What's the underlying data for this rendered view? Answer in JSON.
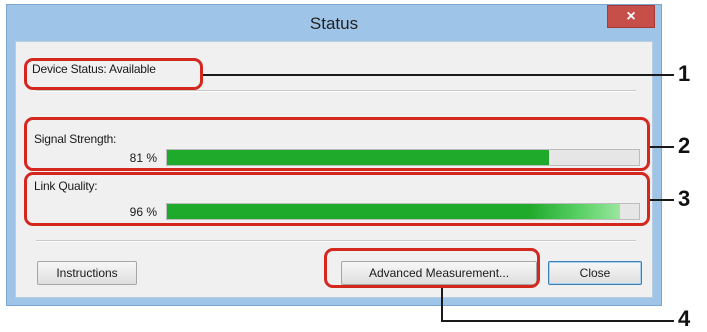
{
  "dialog": {
    "title": "Status",
    "close_glyph": "×"
  },
  "device_status": {
    "label": "Device Status: Available"
  },
  "signal_strength": {
    "label": "Signal Strength:",
    "value_text": "81 %",
    "value": 0.81,
    "bar_color": "#1faa2c"
  },
  "link_quality": {
    "label": "Link Quality:",
    "value_text": "96 %",
    "value": 0.96,
    "bar_color": "#1faa2c"
  },
  "buttons": {
    "instructions": "Instructions",
    "advanced": "Advanced Measurement...",
    "close": "Close"
  },
  "callouts": {
    "c1": "1",
    "c2": "2",
    "c3": "3",
    "c4": "4",
    "color": "#d4281f"
  }
}
